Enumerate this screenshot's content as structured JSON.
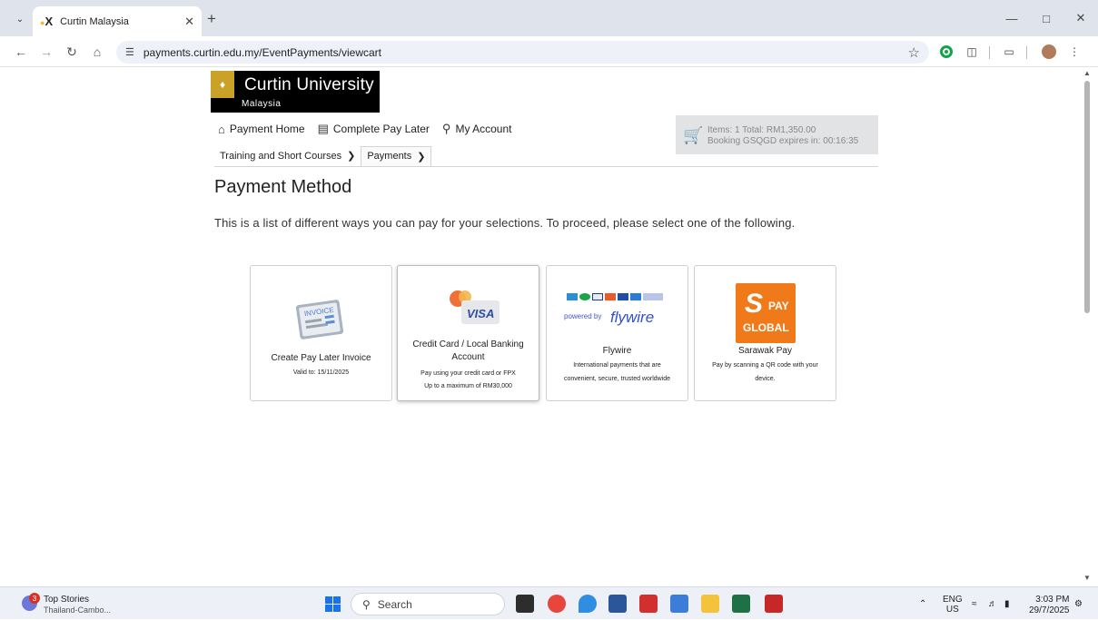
{
  "browser": {
    "tab_title": "Curtin Malaysia",
    "url": "payments.curtin.edu.my/EventPayments/viewcart"
  },
  "logo": {
    "name": "Curtin University",
    "sub": "Malaysia"
  },
  "nav": {
    "items": [
      {
        "label": "Payment Home",
        "icon": "home-icon"
      },
      {
        "label": "Complete Pay Later",
        "icon": "document-icon"
      },
      {
        "label": "My Account",
        "icon": "user-icon"
      }
    ]
  },
  "cart": {
    "line1": "Items: 1 Total: RM1,350.00",
    "line2": "Booking GSQGD expires in: 00:16:35"
  },
  "breadcrumb": {
    "items": [
      "Training and Short Courses",
      "Payments"
    ]
  },
  "page": {
    "heading": "Payment Method",
    "intro": "This is a list of different ways you can pay for your selections. To proceed, please select one of the following."
  },
  "methods": [
    {
      "title": "Create Pay Later Invoice",
      "lines": [
        "Valid to: 15/11/2025"
      ],
      "icon_text": "INVOICE"
    },
    {
      "title": "Credit Card / Local Banking Account",
      "lines": [
        "Pay using your credit card or FPX",
        "Up to a maximum of RM30,000"
      ],
      "icon_text": "VISA"
    },
    {
      "title": "Flywire",
      "lines": [
        "International payments that are",
        "convenient, secure, trusted worldwide"
      ],
      "powered_by": "powered by",
      "brand": "flywire"
    },
    {
      "title": "Sarawak Pay",
      "lines": [
        "Pay by scanning a QR code with your",
        "device."
      ],
      "logo_s": "S",
      "logo_pay": "PAY",
      "logo_global": "GLOBAL"
    }
  ],
  "taskbar": {
    "news_badge": "3",
    "news_title": "Top Stories",
    "news_sub": "Thailand-Cambo...",
    "search": "Search",
    "lang_top": "ENG",
    "lang_bottom": "US",
    "time": "3:03 PM",
    "date": "29/7/2025"
  },
  "colors": {
    "accent_orange": "#f07a1a",
    "flywire_blue": "#3050c8",
    "windows_blue": "#1a73e8"
  }
}
